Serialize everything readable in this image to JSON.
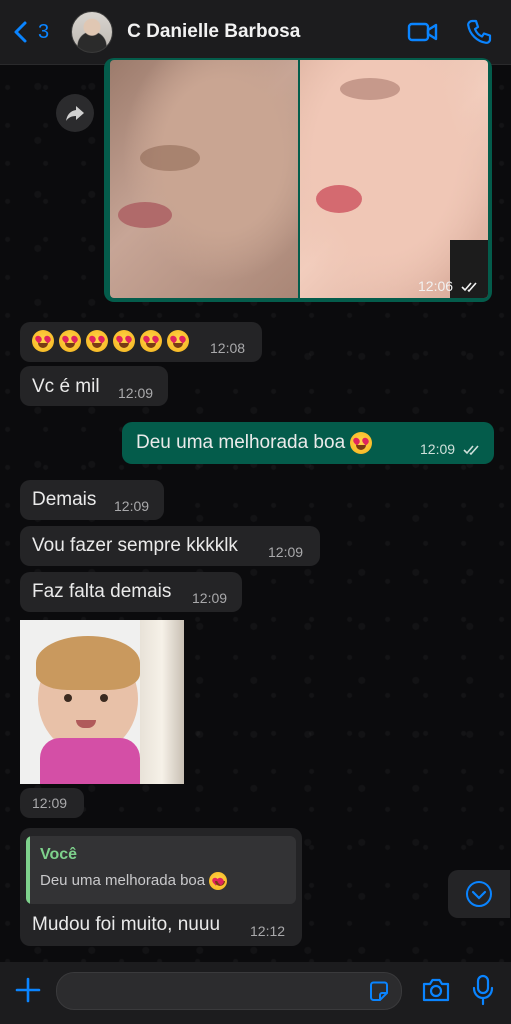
{
  "header": {
    "back_count": "3",
    "contact_name": "C Danielle Barbosa",
    "icons": [
      "chevron-left-icon",
      "video-call-icon",
      "phone-icon"
    ]
  },
  "messages": [
    {
      "type": "image",
      "direction": "out",
      "time": "12:06",
      "status": "read"
    },
    {
      "type": "text",
      "direction": "in",
      "text": "😍😍😍😍😍😍",
      "time": "12:08"
    },
    {
      "type": "text",
      "direction": "in",
      "text": "Vc é mil",
      "time": "12:09"
    },
    {
      "type": "text",
      "direction": "out",
      "text": "Deu uma melhorada boa 😍",
      "time": "12:09",
      "status": "read"
    },
    {
      "type": "text",
      "direction": "in",
      "text": "Demais",
      "time": "12:09"
    },
    {
      "type": "text",
      "direction": "in",
      "text": "Vou fazer sempre kkkklk",
      "time": "12:09"
    },
    {
      "type": "text",
      "direction": "in",
      "text": "Faz falta demais",
      "time": "12:09"
    },
    {
      "type": "sticker",
      "direction": "in",
      "time": "12:09"
    },
    {
      "type": "reply",
      "direction": "in",
      "quote_author": "Você",
      "quote_text": "Deu uma melhorada boa 😍",
      "text": "Mudou foi muito, nuuu",
      "time": "12:12"
    }
  ],
  "colors": {
    "accent": "#0a84ff",
    "incoming_bubble": "#242426",
    "outgoing_bubble": "#045c4b",
    "quote_author": "#7ed18c"
  },
  "composer": {
    "icons": [
      "plus-icon",
      "sticker-icon",
      "camera-icon",
      "microphone-icon"
    ]
  }
}
